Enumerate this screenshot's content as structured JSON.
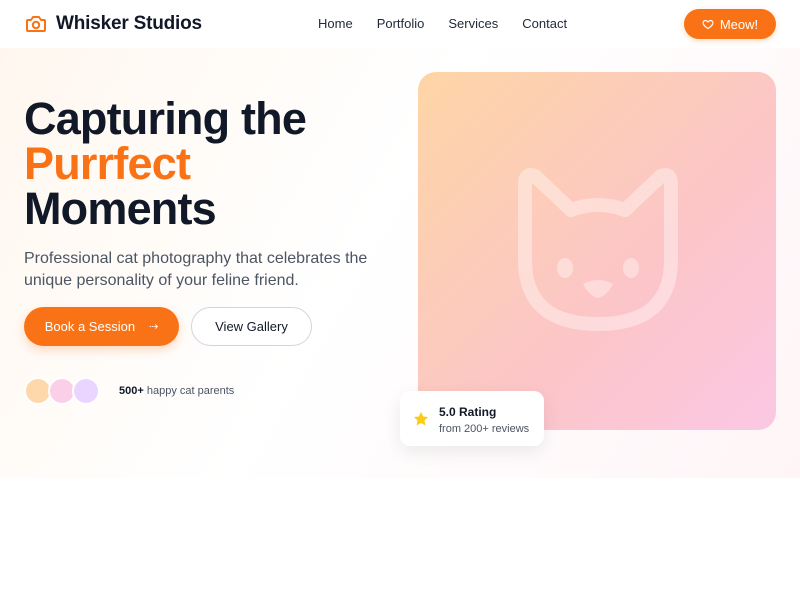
{
  "header": {
    "brand_name": "Whisker Studios",
    "brand_icon": "camera-icon",
    "nav": [
      "Home",
      "Portfolio",
      "Services",
      "Contact"
    ],
    "cta_label": "Meow!",
    "cta_icon": "heart-icon"
  },
  "hero": {
    "headline_line1": "Capturing the",
    "headline_accent": "Purrfect",
    "headline_line3": "Moments",
    "subtitle": "Professional cat photography that celebrates the unique personality of your feline friend.",
    "primary_button": "Book a Session",
    "primary_button_icon": "arrow-right-icon",
    "secondary_button": "View Gallery",
    "social_count": "500+",
    "social_text": "happy cat parents",
    "illustration_icon": "cat-face-icon"
  },
  "rating": {
    "title": "5.0 Rating",
    "subtitle": "from 200+ reviews",
    "icon": "star-icon"
  },
  "colors": {
    "accent": "#f97316",
    "text_dark": "#111827",
    "text_muted": "#4b5563",
    "star": "#facc15"
  }
}
